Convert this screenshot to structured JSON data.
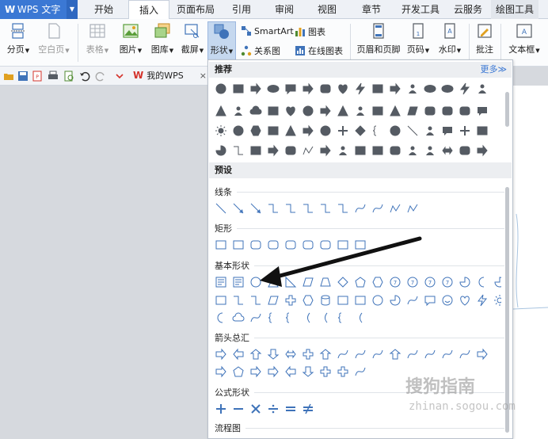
{
  "app": {
    "name": "WPS 文字"
  },
  "tabs": [
    {
      "label": "开始"
    },
    {
      "label": "插入",
      "active": true
    },
    {
      "label": "页面布局"
    },
    {
      "label": "引用"
    },
    {
      "label": "审阅"
    },
    {
      "label": "视图"
    },
    {
      "label": "章节"
    },
    {
      "label": "开发工具"
    },
    {
      "label": "云服务"
    },
    {
      "label": "绘图工具"
    }
  ],
  "ribbon": {
    "page_break": "分页",
    "blank_page": "空白页",
    "table": "表格",
    "picture": "图片",
    "gallery": "图库",
    "screenshot": "截屏",
    "shapes": "形状",
    "smartart": "SmartArt",
    "chart": "图表",
    "relation_map": "关系图",
    "online_chart": "在线图表",
    "header_footer": "页眉和页脚",
    "page_number": "页码",
    "watermark": "水印",
    "comment": "批注",
    "textbox": "文本框"
  },
  "quick_access": {
    "doc_tab": "我的WPS",
    "close": "×"
  },
  "shapes_panel": {
    "recommended": "推荐",
    "more": "更多≫",
    "presets": "预设",
    "lines": "线条",
    "rectangles": "矩形",
    "basic_shapes": "基本形状",
    "block_arrows": "箭头总汇",
    "equation_shapes": "公式形状",
    "flowchart": "流程图"
  },
  "watermark": {
    "brand": "搜狗指南",
    "url": "zhinan.sogou.com"
  },
  "colors": {
    "accent": "#3b78d4",
    "icon_blue": "#3f73b9",
    "icon_dark": "#555b63"
  }
}
